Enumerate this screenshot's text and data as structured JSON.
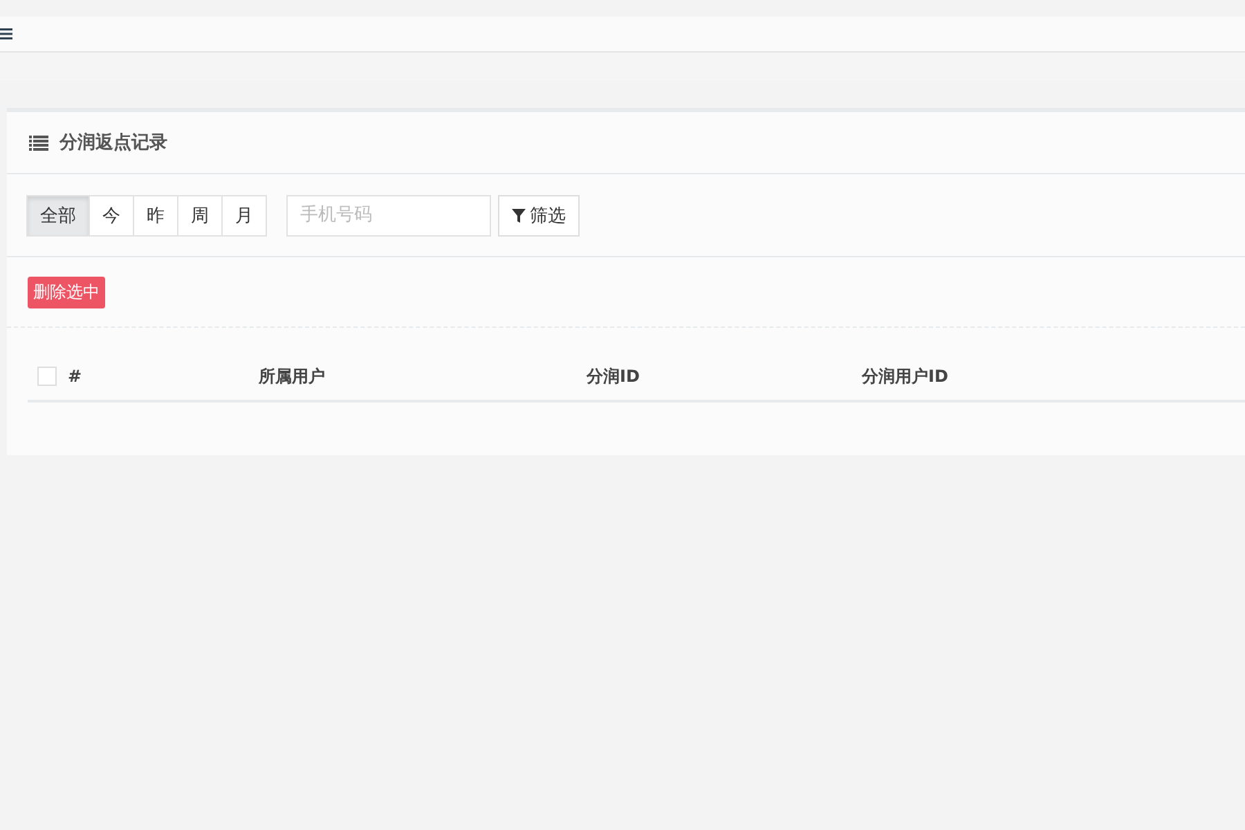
{
  "card": {
    "title": "分润返点记录"
  },
  "date_tabs": [
    {
      "label": "全部",
      "selected": true
    },
    {
      "label": "今",
      "selected": false
    },
    {
      "label": "昨",
      "selected": false
    },
    {
      "label": "周",
      "selected": false
    },
    {
      "label": "月",
      "selected": false
    }
  ],
  "search": {
    "placeholder": "手机号码"
  },
  "filter_button": "筛选",
  "delete_button": "删除选中",
  "table": {
    "select_all_checked": false,
    "columns": [
      "#",
      "所属用户",
      "分润ID",
      "分润用户ID"
    ]
  }
}
